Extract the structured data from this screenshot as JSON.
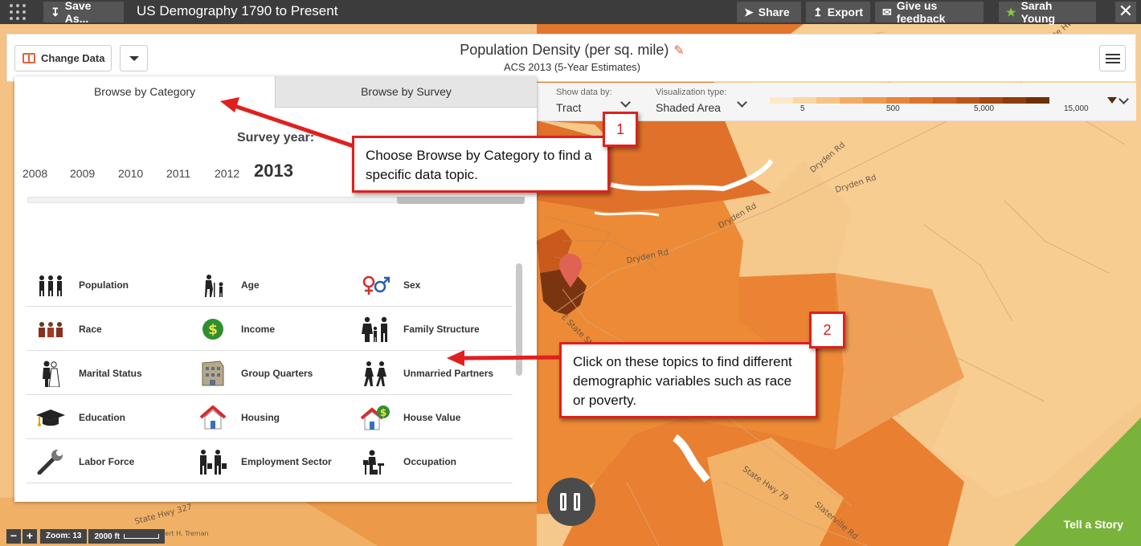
{
  "topbar": {
    "save_label": "Save As...",
    "app_title": "US Demography 1790 to Present",
    "share_label": "Share",
    "export_label": "Export",
    "feedback_label": "Give us feedback",
    "user_name": "Sarah Young"
  },
  "header": {
    "change_data_label": "Change Data",
    "title": "Population Density (per sq. mile)",
    "subtitle": "ACS 2013 (5-Year Estimates)"
  },
  "legend": {
    "show_by_caption": "Show data by:",
    "show_by_value": "Tract",
    "viz_caption": "Visualization type:",
    "viz_value": "Shaded Area",
    "ramp_colors": [
      "#fde9c8",
      "#f9d7a4",
      "#f6c482",
      "#f2ab62",
      "#ee9a4c",
      "#e8873a",
      "#df742b",
      "#d26423",
      "#bf5419",
      "#a84711",
      "#8e3c0b",
      "#6f2f07"
    ],
    "ticks": [
      "5",
      "500",
      "5,000",
      "15,000"
    ]
  },
  "panel": {
    "tab_category": "Browse by Category",
    "tab_survey": "Browse by Survey",
    "survey_year_label": "Survey year:",
    "years": [
      "2008",
      "2009",
      "2010",
      "2011",
      "2012"
    ],
    "selected_year": "2013",
    "categories": [
      [
        "Population",
        "Age",
        "Sex"
      ],
      [
        "Race",
        "Income",
        "Family Structure"
      ],
      [
        "Marital Status",
        "Group Quarters",
        "Unmarried Partners"
      ],
      [
        "Education",
        "Housing",
        "House Value"
      ],
      [
        "Labor Force",
        "Employment Sector",
        "Occupation"
      ]
    ]
  },
  "callouts": {
    "one_number": "1",
    "one_text": "Choose Browse by Category to find a specific data topic.",
    "two_number": "2",
    "two_text": "Click on these topics to find different demographic variables such as race or poverty."
  },
  "map": {
    "labels": [
      "Dryden Rd",
      "Dryden Rd",
      "Dryden Rd",
      "Dryden Rd",
      "E State St",
      "State Hwy 79",
      "Slaterville Rd",
      "State Hwy 327",
      "State Hwy 13",
      "Robert H. Treman"
    ]
  },
  "bottom": {
    "zoom_label": "Zoom: 13",
    "scale_label": "2000 ft",
    "story_label": "Tell a Story"
  }
}
